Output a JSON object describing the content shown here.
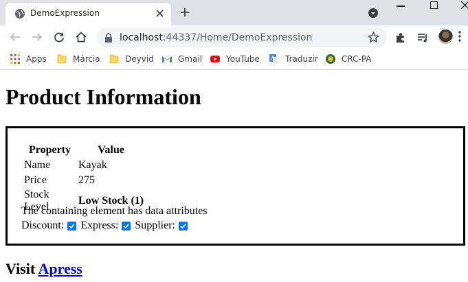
{
  "browser": {
    "tab_title": "DemoExpression",
    "url_host": "localhost",
    "url_port_path": ":44337/Home/DemoExpression",
    "bookmarks": [
      {
        "label": "Apps",
        "icon": "apps-grid-icon"
      },
      {
        "label": "Márcia",
        "icon": "folder-icon"
      },
      {
        "label": "Deyvid",
        "icon": "folder-icon"
      },
      {
        "label": "Gmail",
        "icon": "gmail-icon"
      },
      {
        "label": "YouTube",
        "icon": "youtube-icon"
      },
      {
        "label": "Traduzir",
        "icon": "google-translate-icon"
      },
      {
        "label": "CRC-PA",
        "icon": "crc-pa-icon"
      }
    ]
  },
  "page": {
    "heading": "Product Information",
    "table": {
      "headers": [
        "Property",
        "Value"
      ],
      "rows": [
        {
          "property": "Name",
          "value": "Kayak"
        },
        {
          "property": "Price",
          "value": "275"
        },
        {
          "property": "Stock Level",
          "value": "Low Stock (1)"
        }
      ]
    },
    "note": "The containing element has data attributes",
    "flags": [
      {
        "label": "Discount:",
        "checked": true
      },
      {
        "label": "Express:",
        "checked": true
      },
      {
        "label": "Supplier:",
        "checked": true
      }
    ],
    "visit_prefix": "Visit",
    "visit_link": "Apress"
  },
  "colors": {
    "tabstrip": "#dee1e6",
    "checkbox_accent": "#0075ff",
    "link": "#0000ee"
  }
}
